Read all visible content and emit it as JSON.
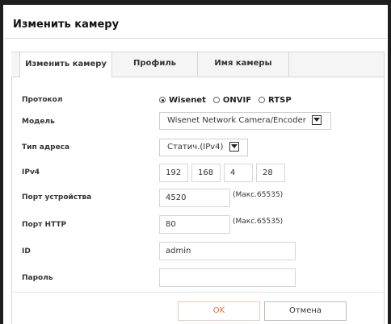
{
  "dialog": {
    "title": "Изменить камеру"
  },
  "tabs": [
    {
      "label": "Изменить камеру",
      "active": true
    },
    {
      "label": "Профиль",
      "active": false
    },
    {
      "label": "Имя камеры",
      "active": false
    }
  ],
  "form": {
    "protocol": {
      "label": "Протокол",
      "options": [
        "Wisenet",
        "ONVIF",
        "RTSP"
      ],
      "selected": "Wisenet"
    },
    "model": {
      "label": "Модель",
      "value": "Wisenet Network Camera/Encoder"
    },
    "address_type": {
      "label": "Тип адреса",
      "value": "Статич.(IPv4)"
    },
    "ipv4": {
      "label": "IPv4",
      "octets": [
        "192",
        "168",
        "4",
        "28"
      ]
    },
    "device_port": {
      "label": "Порт устройства",
      "value": "4520",
      "hint": "(Макс.65535)"
    },
    "http_port": {
      "label": "Порт HTTP",
      "value": "80",
      "hint": "(Макс.65535)"
    },
    "id": {
      "label": "ID",
      "value": "admin"
    },
    "password": {
      "label": "Пароль",
      "value": ""
    }
  },
  "buttons": {
    "ok": "OK",
    "cancel": "Отмена"
  },
  "colors": {
    "accent": "#e06d3a",
    "border": "#d6d6d6",
    "window_edge": "#1e1e1e"
  }
}
